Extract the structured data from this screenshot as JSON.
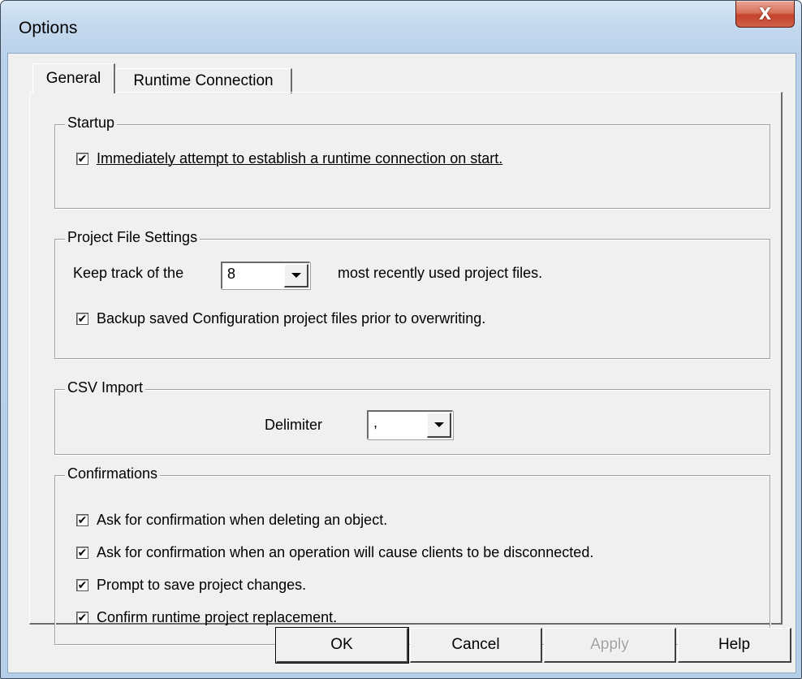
{
  "window": {
    "title": "Options",
    "close_glyph": "X"
  },
  "tabs": [
    {
      "label": "General",
      "selected": true
    },
    {
      "label": "Runtime Connection",
      "selected": false
    }
  ],
  "startup": {
    "legend": "Startup",
    "auto_connect": {
      "label": "Immediately attempt to establish a runtime connection on start.",
      "checked": true
    }
  },
  "project_file": {
    "legend": "Project File Settings",
    "mru_prefix": "Keep track of the",
    "mru_value": "8",
    "mru_suffix": "most recently used project files.",
    "backup": {
      "label": "Backup saved Configuration project files prior to overwriting.",
      "checked": true
    }
  },
  "csv": {
    "legend": "CSV Import",
    "delimiter_label": "Delimiter",
    "delimiter_value": ","
  },
  "confirmations": {
    "legend": "Confirmations",
    "items": [
      {
        "label": "Ask for confirmation when deleting an object.",
        "checked": true
      },
      {
        "label": "Ask for confirmation when an operation will cause clients to be disconnected.",
        "checked": true
      },
      {
        "label": "Prompt to save project changes.",
        "checked": true
      },
      {
        "label": "Confirm runtime project replacement.",
        "checked": true
      }
    ]
  },
  "buttons": {
    "ok": "OK",
    "cancel": "Cancel",
    "apply": "Apply",
    "help": "Help"
  },
  "check_glyph": "✔"
}
